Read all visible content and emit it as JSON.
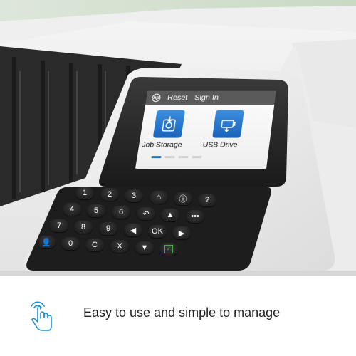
{
  "screen": {
    "header": {
      "logo_text": "hp",
      "reset_label": "Reset",
      "sign_in_label": "Sign In"
    },
    "tiles": [
      {
        "label": "Job Storage",
        "icon": "job-storage-icon"
      },
      {
        "label": "USB Drive",
        "icon": "usb-drive-icon"
      }
    ],
    "page_indicator": {
      "count": 4,
      "active_index": 0
    }
  },
  "keypad": {
    "keys": [
      "1",
      "2",
      "3",
      "4",
      "5",
      "6",
      "7",
      "8",
      "9",
      "0",
      "C",
      "*",
      "#",
      "OK",
      "X",
      "home-icon",
      "info-icon",
      "help-icon",
      "back-icon",
      "up-icon",
      "chat-icon",
      "user-icon",
      "left-icon",
      "right-icon",
      "down-icon",
      "start-icon"
    ]
  },
  "caption": {
    "text": "Easy to use and simple to manage",
    "icon": "touch-hand-icon"
  },
  "colors": {
    "accent": "#1f8fcf",
    "tile_blue": "#1f6fc5",
    "start_green": "#3fae3a"
  }
}
